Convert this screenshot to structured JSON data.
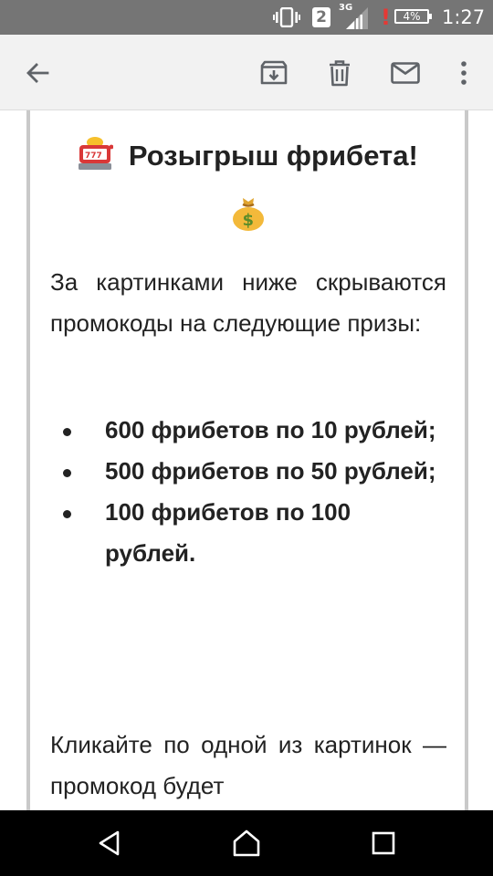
{
  "status_bar": {
    "sim_slot": "2",
    "network_type": "3G",
    "battery": "4%",
    "time": "1:27"
  },
  "toolbar": {
    "icons": [
      "back-arrow-icon",
      "archive-icon",
      "delete-icon",
      "mark-unread-icon",
      "more-vert-icon"
    ]
  },
  "email": {
    "title": "Розыгрыш фрибета!",
    "intro": "За картинками ниже скрываются промокоды на следующие призы:",
    "prizes": [
      "600 фрибетов по 10 рублей;",
      "500 фрибетов по 50 рублей;",
      "100 фрибетов по 100 рублей."
    ],
    "cta": "Кликайте по одной из картинок — промокод будет"
  },
  "nav_bar": {
    "icons": [
      "back-triangle-icon",
      "home-icon",
      "recents-icon"
    ]
  },
  "colors": {
    "status_bar": "#757575",
    "toolbar_bg": "#f2f2f2",
    "toolbar_icon": "#5f6368",
    "text": "#222222",
    "card_border": "#c9c9c9",
    "battery_alert": "#e53935",
    "nav_bar": "#000000"
  }
}
